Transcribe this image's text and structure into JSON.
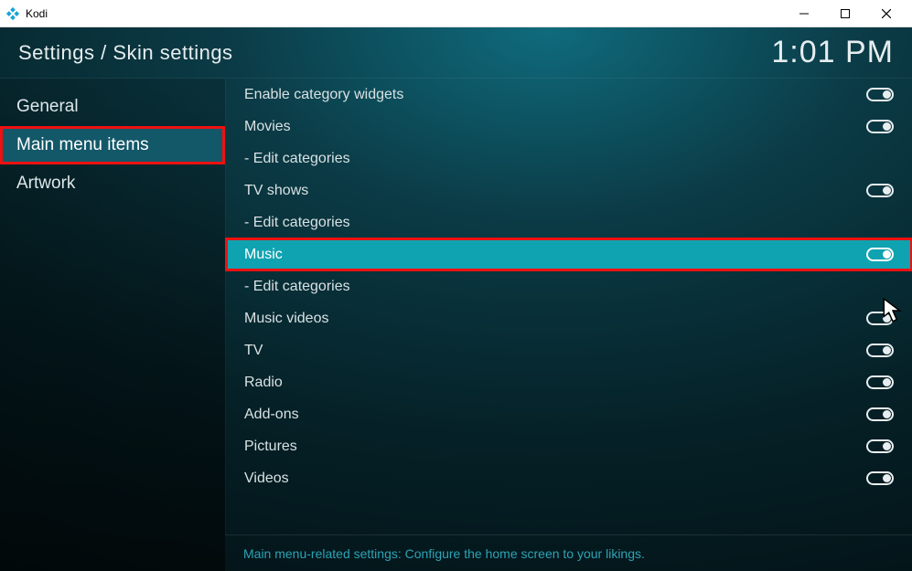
{
  "window": {
    "app_name": "Kodi"
  },
  "header": {
    "breadcrumb": "Settings / Skin settings",
    "clock": "1:01 PM"
  },
  "sidebar": {
    "items": [
      {
        "label": "General",
        "selected": false,
        "annotated": false
      },
      {
        "label": "Main menu items",
        "selected": true,
        "annotated": true
      },
      {
        "label": "Artwork",
        "selected": false,
        "annotated": false
      }
    ]
  },
  "settings": {
    "rows": [
      {
        "label": "Enable category widgets",
        "toggle": true,
        "hover": false,
        "annotated": false
      },
      {
        "label": "Movies",
        "toggle": true,
        "hover": false,
        "annotated": false
      },
      {
        "label": "- Edit categories",
        "toggle": null,
        "hover": false,
        "annotated": false
      },
      {
        "label": "TV shows",
        "toggle": true,
        "hover": false,
        "annotated": false
      },
      {
        "label": "- Edit categories",
        "toggle": null,
        "hover": false,
        "annotated": false
      },
      {
        "label": "Music",
        "toggle": true,
        "hover": true,
        "annotated": true
      },
      {
        "label": "- Edit categories",
        "toggle": null,
        "hover": false,
        "annotated": false
      },
      {
        "label": "Music videos",
        "toggle": true,
        "hover": false,
        "annotated": false
      },
      {
        "label": "TV",
        "toggle": true,
        "hover": false,
        "annotated": false
      },
      {
        "label": "Radio",
        "toggle": true,
        "hover": false,
        "annotated": false
      },
      {
        "label": "Add-ons",
        "toggle": true,
        "hover": false,
        "annotated": false
      },
      {
        "label": "Pictures",
        "toggle": true,
        "hover": false,
        "annotated": false
      },
      {
        "label": "Videos",
        "toggle": true,
        "hover": false,
        "annotated": false
      }
    ],
    "help_text": "Main menu-related settings: Configure the home screen to your likings."
  }
}
